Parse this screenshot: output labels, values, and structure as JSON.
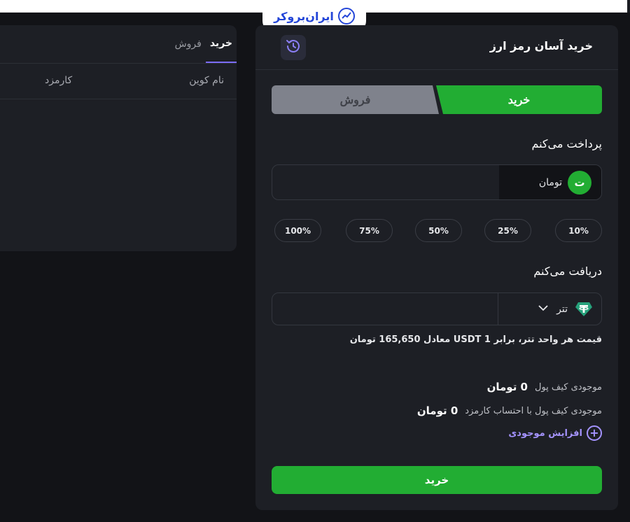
{
  "brand": {
    "logo_text": "ایران‌بروکر",
    "logo_color": "#2446d8"
  },
  "left_panel": {
    "tabs": [
      {
        "label": "خرید",
        "active": true
      },
      {
        "label": "فروش",
        "active": false
      }
    ],
    "columns": {
      "name": "نام کوین",
      "fee": "کارمزد"
    }
  },
  "right_panel": {
    "title": "خرید آسان رمز ارز",
    "history_icon": "history-icon",
    "toggle": {
      "buy": "خرید",
      "sell": "فروش",
      "active": "buy"
    },
    "pay": {
      "label": "پرداخت می‌کنم",
      "currency": "تومان",
      "currency_icon_glyph": "ت",
      "amount": ""
    },
    "percent_options": [
      "10%",
      "25%",
      "50%",
      "75%",
      "100%"
    ],
    "receive": {
      "label": "دریافت می‌کنم",
      "currency": "تتر",
      "amount": ""
    },
    "rate_text": "قیمت هر واحد تتر، برابر USDT 1 معادل 165,650 تومان",
    "balance": {
      "wallet_label": "موجودی کیف پول",
      "wallet_value": "0 تومان",
      "after_fee_label": "موجودی کیف پول با احتساب کارمزد",
      "after_fee_value": "0 تومان"
    },
    "increase_label": "افزایش موجودی",
    "submit_label": "خرید"
  },
  "colors": {
    "accent_green": "#22ad33",
    "accent_purple": "#a493ff",
    "tether": "#26a17b"
  }
}
